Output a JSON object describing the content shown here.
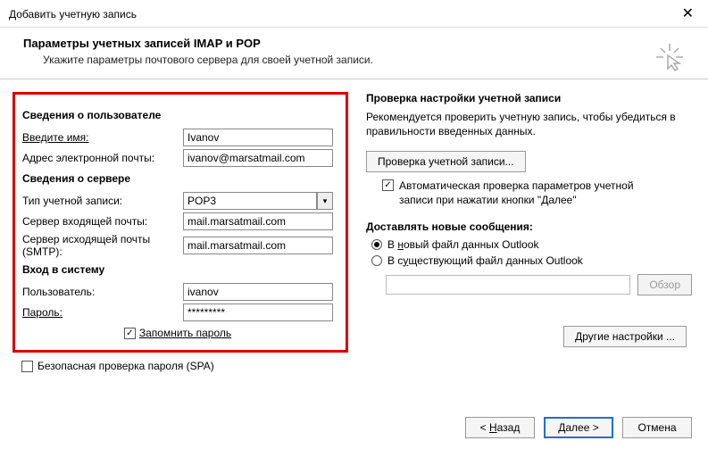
{
  "titlebar": {
    "title": "Добавить учетную запись"
  },
  "subheader": {
    "title": "Параметры учетных записей IMAP и POP",
    "desc": "Укажите параметры почтового сервера для своей учетной записи."
  },
  "user_info": {
    "heading": "Сведения о пользователе",
    "name_label": "Введите имя:",
    "name_value": "Ivanov",
    "email_label": "Адрес электронной почты:",
    "email_value": "ivanov@marsatmail.com"
  },
  "server_info": {
    "heading": "Сведения о сервере",
    "type_label": "Тип учетной записи:",
    "type_value": "POP3",
    "incoming_label": "Сервер входящей почты:",
    "incoming_value": "mail.marsatmail.com",
    "outgoing_label": "Сервер исходящей почты (SMTP):",
    "outgoing_value": "mail.marsatmail.com"
  },
  "login": {
    "heading": "Вход в систему",
    "user_label": "Пользователь:",
    "user_value": "ivanov",
    "pass_label": "Пароль:",
    "pass_value": "*********",
    "remember_label": "Запомнить пароль"
  },
  "spa_label": "Безопасная проверка пароля (SPA)",
  "test": {
    "heading": "Проверка настройки учетной записи",
    "desc": "Рекомендуется проверить учетную запись, чтобы убедиться в правильности введенных данных.",
    "button": "Проверка учетной записи...",
    "auto_check_label": "Автоматическая проверка параметров учетной записи при нажатии кнопки \"Далее\""
  },
  "delivery": {
    "heading": "Доставлять новые сообщения:",
    "radio_new_pre": "В ",
    "radio_new_u": "н",
    "radio_new_post": "овый файл данных Outlook",
    "radio_exist_pre": "В с",
    "radio_exist_u": "у",
    "radio_exist_post": "ществующий файл данных Outlook",
    "browse": "Обзор"
  },
  "other_settings": "Другие настройки ...",
  "footer": {
    "back_pre": "< ",
    "back_u": "Н",
    "back_post": "азад",
    "next_u": "Д",
    "next_post": "алее >",
    "cancel": "Отмена"
  }
}
